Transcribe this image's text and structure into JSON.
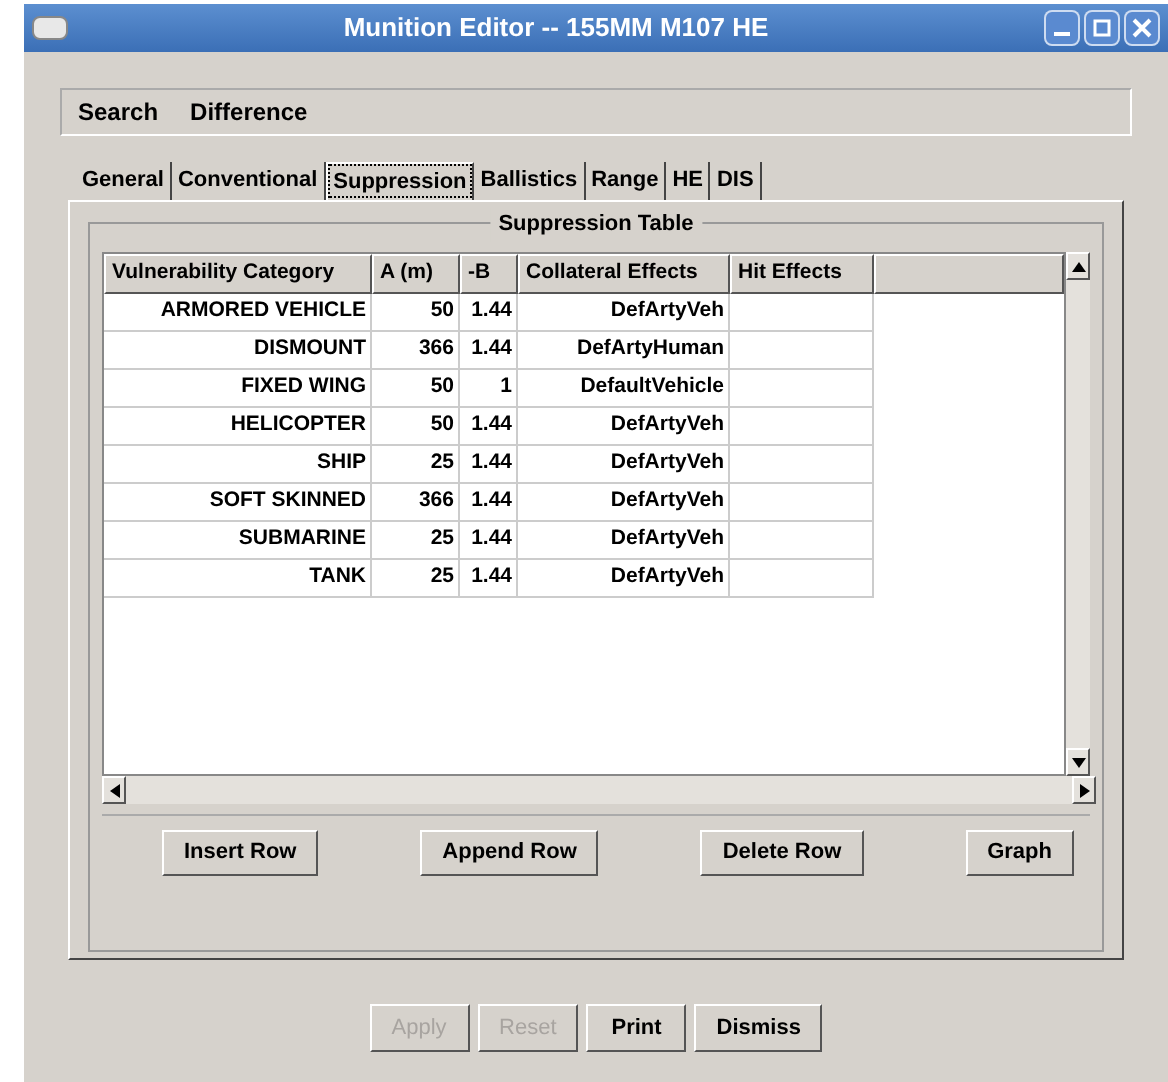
{
  "window": {
    "title": "Munition Editor -- 155MM M107 HE"
  },
  "menu": [
    "Search",
    "Difference"
  ],
  "tabs": [
    {
      "label": "General",
      "selected": false
    },
    {
      "label": "Conventional",
      "selected": false
    },
    {
      "label": "Suppression",
      "selected": true
    },
    {
      "label": "Ballistics",
      "selected": false
    },
    {
      "label": "Range",
      "selected": false
    },
    {
      "label": "HE",
      "selected": false
    },
    {
      "label": "DIS",
      "selected": false
    }
  ],
  "group_title": "Suppression Table",
  "table": {
    "columns": [
      "Vulnerability Category",
      "A (m)",
      "-B",
      "Collateral Effects",
      "Hit Effects"
    ],
    "rows": [
      [
        "ARMORED VEHICLE",
        "50",
        "1.44",
        "DefArtyVeh"
      ],
      [
        "DISMOUNT",
        "366",
        "1.44",
        "DefArtyHuman"
      ],
      [
        "FIXED WING",
        "50",
        "1",
        "DefaultVehicle"
      ],
      [
        "HELICOPTER",
        "50",
        "1.44",
        "DefArtyVeh"
      ],
      [
        "SHIP",
        "25",
        "1.44",
        "DefArtyVeh"
      ],
      [
        "SOFT SKINNED",
        "366",
        "1.44",
        "DefArtyVeh"
      ],
      [
        "SUBMARINE",
        "25",
        "1.44",
        "DefArtyVeh"
      ],
      [
        "TANK",
        "25",
        "1.44",
        "DefArtyVeh"
      ]
    ]
  },
  "table_buttons": [
    "Insert Row",
    "Append Row",
    "Delete Row",
    "Graph"
  ],
  "dialog_buttons": [
    {
      "label": "Apply",
      "disabled": true
    },
    {
      "label": "Reset",
      "disabled": true
    },
    {
      "label": "Print",
      "disabled": false
    },
    {
      "label": "Dismiss",
      "disabled": false
    }
  ]
}
